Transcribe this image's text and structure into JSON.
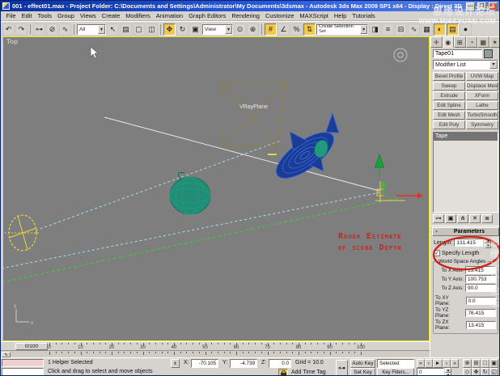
{
  "window": {
    "title": "001 - effect01.max - Project Folder: C:\\Documents and Settings\\Administrator\\My Documents\\3dsmax - Autodesk 3ds Max 2009 SP1  x64 - Display : Direct 3D",
    "minimize": "—",
    "maximize": "❐",
    "close": "✕"
  },
  "watermark": {
    "line1": "思缘设计论坛",
    "line2": "WWW.MISSYUAN.COM",
    "vertical": "思缘设计论坛"
  },
  "menu": {
    "items": [
      "File",
      "Edit",
      "Tools",
      "Group",
      "Views",
      "Create",
      "Modifiers",
      "Animation",
      "Graph Editors",
      "Rendering",
      "Customize",
      "MAXScript",
      "Help",
      "Tutorials"
    ]
  },
  "toolbar": {
    "selection_filter": "All",
    "coord_system": "View",
    "named_sets": "Create Selection Set",
    "icons": [
      {
        "name": "undo-icon",
        "glyph": "↶"
      },
      {
        "name": "redo-icon",
        "glyph": "↷"
      },
      {
        "name": "select-link-icon",
        "glyph": "⊶"
      },
      {
        "name": "unlink-icon",
        "glyph": "⊘"
      },
      {
        "name": "bind-spacewarp-icon",
        "glyph": "∿"
      },
      {
        "name": "select-object-icon",
        "glyph": "↖"
      },
      {
        "name": "select-by-name-icon",
        "glyph": "▤"
      },
      {
        "name": "rect-region-icon",
        "glyph": "▢"
      },
      {
        "name": "window-crossing-icon",
        "glyph": "◫"
      },
      {
        "name": "select-move-icon",
        "glyph": "✥"
      },
      {
        "name": "select-rotate-icon",
        "glyph": "↻"
      },
      {
        "name": "select-scale-icon",
        "glyph": "▣"
      },
      {
        "name": "pivot-center-icon",
        "glyph": "⊙"
      },
      {
        "name": "select-manipulate-icon",
        "glyph": "⊕"
      },
      {
        "name": "snap-3d-icon",
        "glyph": "#"
      },
      {
        "name": "angle-snap-icon",
        "glyph": "∠"
      },
      {
        "name": "percent-snap-icon",
        "glyph": "%"
      },
      {
        "name": "spinner-snap-icon",
        "glyph": "⇅"
      },
      {
        "name": "mirror-icon",
        "glyph": "◨"
      },
      {
        "name": "align-icon",
        "glyph": "≡"
      },
      {
        "name": "layer-manager-icon",
        "glyph": "⊟"
      },
      {
        "name": "curve-editor-icon",
        "glyph": "∿"
      },
      {
        "name": "schematic-view-icon",
        "glyph": "▦"
      },
      {
        "name": "material-editor-icon",
        "glyph": "◐"
      },
      {
        "name": "render-setup-icon",
        "glyph": "▤"
      },
      {
        "name": "render-icon",
        "glyph": "●"
      }
    ]
  },
  "viewport": {
    "label": "Top",
    "plane_label": "VRayPlane",
    "annotation": {
      "line1": "Rough Estimate",
      "line2": "of scene Depth"
    }
  },
  "command_panel": {
    "tabs": [
      {
        "name": "create",
        "glyph": "✛"
      },
      {
        "name": "modify",
        "glyph": "◉"
      },
      {
        "name": "hierarchy",
        "glyph": "⊞"
      },
      {
        "name": "motion",
        "glyph": "◔"
      },
      {
        "name": "display",
        "glyph": "▦"
      },
      {
        "name": "utilities",
        "glyph": "✶"
      }
    ],
    "object_name": "Tape01",
    "modifier_list": "Modifier List",
    "modifier_buttons": [
      "Bevel Profile",
      "UVW Map",
      "Sweep",
      "Displace Mesh",
      "Extrude",
      "XForm",
      "Edit Spline",
      "Lathe",
      "Edit Mesh",
      "TurboSmooth",
      "Edit Poly",
      "Symmetry"
    ],
    "stack_selected": "Tape",
    "stack_tools": [
      {
        "name": "pin-stack-icon",
        "glyph": "⊶"
      },
      {
        "name": "show-end-result-icon",
        "glyph": "▣"
      },
      {
        "name": "make-unique-icon",
        "glyph": "⋔"
      },
      {
        "name": "remove-modifier-icon",
        "glyph": "✕"
      },
      {
        "name": "configure-modifier-sets-icon",
        "glyph": "≣"
      }
    ],
    "rollout": {
      "collapse": "-",
      "title": "Parameters",
      "length_label": "Length:",
      "length_value": "131.415",
      "specify_length": "Specify Length",
      "checkbox_mark": "✓",
      "group_title": "World Space Angles",
      "angles": [
        {
          "label": "To X Axis:",
          "value": "13.415"
        },
        {
          "label": "To Y Axis:",
          "value": "100.753"
        },
        {
          "label": "To Z Axis:",
          "value": "90.0"
        },
        {
          "label": "To XY Plane:",
          "value": "0.0"
        },
        {
          "label": "To YZ Plane:",
          "value": "76.415"
        },
        {
          "label": "To ZX Plane:",
          "value": "13.415"
        }
      ]
    }
  },
  "timeline": {
    "handle": "0/100",
    "labels": [
      "0",
      "10",
      "20",
      "30",
      "40",
      "50",
      "60",
      "70",
      "80",
      "90",
      "100"
    ],
    "curve_editor_button": "∿"
  },
  "status_bar": {
    "status": "1 Helper Selected",
    "prompt": "Click and drag to select and move objects",
    "abs_toggle": "±",
    "x_label": "X:",
    "x_value": "-70.105",
    "y_label": "Y:",
    "y_value": "-4.739",
    "z_label": "Z:",
    "z_value": "0.0",
    "grid": "Grid = 10.0",
    "add_time_tag": "Add Time Tag",
    "key_button": "⊶",
    "auto_key": "Auto Key",
    "set_key": "Set Key",
    "selected": "Selected",
    "key_filters": "Key Filters...",
    "frame": "0",
    "transport": [
      {
        "name": "go-to-start",
        "glyph": "«"
      },
      {
        "name": "previous-frame",
        "glyph": "‹"
      },
      {
        "name": "play",
        "glyph": "►"
      },
      {
        "name": "next-frame",
        "glyph": "›"
      },
      {
        "name": "go-to-end",
        "glyph": "»"
      }
    ],
    "nav": [
      {
        "name": "zoom",
        "glyph": "⊕"
      },
      {
        "name": "zoom-all",
        "glyph": "⊞"
      },
      {
        "name": "zoom-extents",
        "glyph": "□"
      },
      {
        "name": "zoom-extents-all",
        "glyph": "▣"
      },
      {
        "name": "zoom-region",
        "glyph": "◇"
      },
      {
        "name": "pan",
        "glyph": "✥"
      },
      {
        "name": "orbit",
        "glyph": "↻"
      },
      {
        "name": "maximize-viewport-toggle",
        "glyph": "◱"
      }
    ]
  }
}
